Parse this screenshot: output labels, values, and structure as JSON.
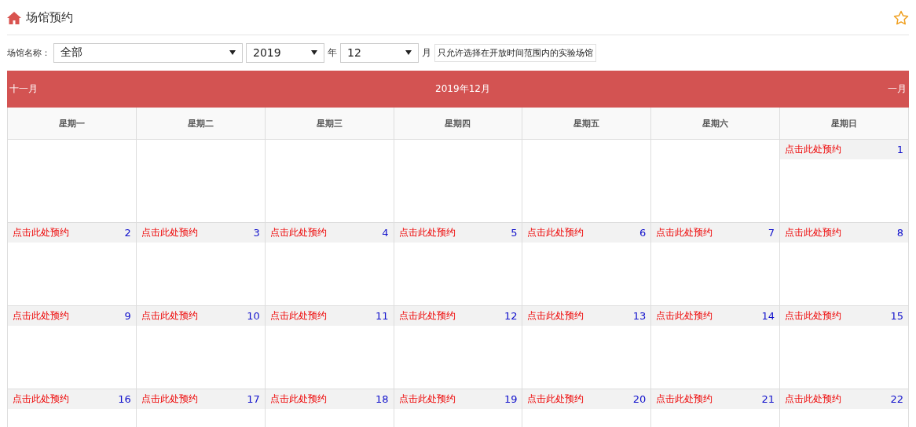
{
  "page": {
    "title": "场馆预约"
  },
  "filters": {
    "venue_label": "场馆名称：",
    "venue": "全部",
    "year": "2019",
    "year_unit": "年",
    "month": "12",
    "month_unit": "月",
    "option_label": "只允许选择在开放时间范围内的实验场馆"
  },
  "calendar": {
    "prev": "十一月",
    "title": "2019年12月",
    "next": "一月",
    "weekdays": [
      "星期一",
      "星期二",
      "星期三",
      "星期四",
      "星期五",
      "星期六",
      "星期日"
    ],
    "weeks": [
      [
        {
          "kind": "empty"
        },
        {
          "kind": "empty"
        },
        {
          "kind": "empty"
        },
        {
          "kind": "empty"
        },
        {
          "kind": "empty"
        },
        {
          "kind": "empty"
        },
        {
          "kind": "day",
          "link": "点击此处预约",
          "day": "1"
        }
      ],
      [
        {
          "kind": "day",
          "link": "点击此处预约",
          "day": "2"
        },
        {
          "kind": "day",
          "link": "点击此处预约",
          "day": "3"
        },
        {
          "kind": "day",
          "link": "点击此处预约",
          "day": "4"
        },
        {
          "kind": "day",
          "link": "点击此处预约",
          "day": "5"
        },
        {
          "kind": "day",
          "link": "点击此处预约",
          "day": "6"
        },
        {
          "kind": "day",
          "link": "点击此处预约",
          "day": "7"
        },
        {
          "kind": "day",
          "link": "点击此处预约",
          "day": "8"
        }
      ],
      [
        {
          "kind": "day",
          "link": "点击此处预约",
          "day": "9"
        },
        {
          "kind": "day",
          "link": "点击此处预约",
          "day": "10"
        },
        {
          "kind": "day",
          "link": "点击此处预约",
          "day": "11"
        },
        {
          "kind": "day",
          "link": "点击此处预约",
          "day": "12"
        },
        {
          "kind": "day",
          "link": "点击此处预约",
          "day": "13"
        },
        {
          "kind": "day",
          "link": "点击此处预约",
          "day": "14"
        },
        {
          "kind": "day",
          "link": "点击此处预约",
          "day": "15"
        }
      ],
      [
        {
          "kind": "day",
          "link": "点击此处预约",
          "day": "16"
        },
        {
          "kind": "day",
          "link": "点击此处预约",
          "day": "17"
        },
        {
          "kind": "day",
          "link": "点击此处预约",
          "day": "18"
        },
        {
          "kind": "day",
          "link": "点击此处预约",
          "day": "19"
        },
        {
          "kind": "day",
          "link": "点击此处预约",
          "day": "20"
        },
        {
          "kind": "day",
          "link": "点击此处预约",
          "day": "21"
        },
        {
          "kind": "day",
          "link": "点击此处预约",
          "day": "22"
        }
      ]
    ]
  }
}
